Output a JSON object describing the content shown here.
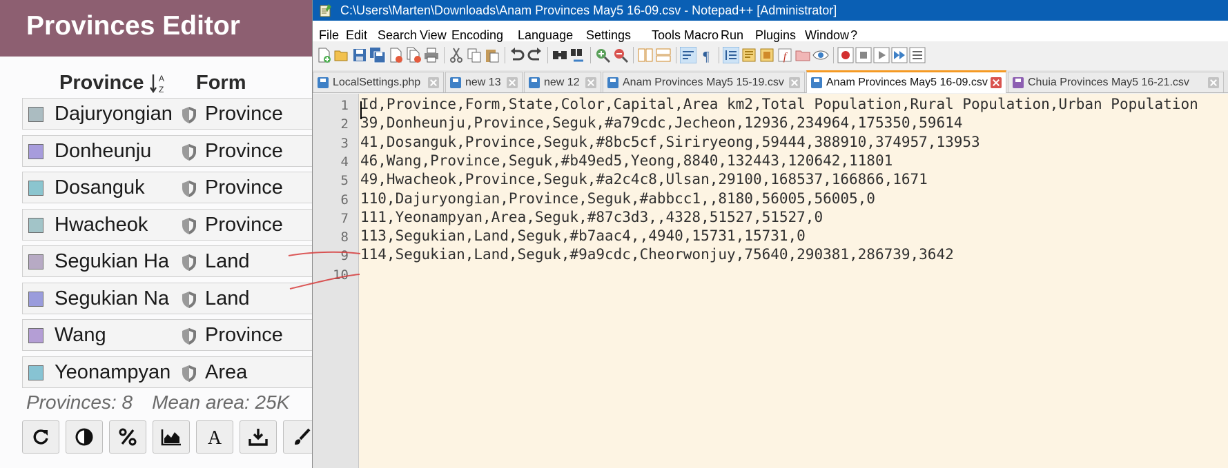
{
  "editor_panel": {
    "title": "Provinces Editor",
    "columns": {
      "province": "Province",
      "form": "Form"
    },
    "rows": [
      {
        "name": "Dajuryongian",
        "form": "Province",
        "color": "#abbcc1"
      },
      {
        "name": "Donheunju",
        "form": "Province",
        "color": "#a79cdc"
      },
      {
        "name": "Dosanguk",
        "form": "Province",
        "color": "#8bc5cf"
      },
      {
        "name": "Hwacheok",
        "form": "Province",
        "color": "#a2c4c8"
      },
      {
        "name": "Segukian Ha",
        "form": "Land",
        "color": "#b7aac4"
      },
      {
        "name": "Segukian Na",
        "form": "Land",
        "color": "#9a9cdc"
      },
      {
        "name": "Wang",
        "form": "Province",
        "color": "#b49ed5"
      },
      {
        "name": "Yeonampyan",
        "form": "Area",
        "color": "#87c3d3"
      }
    ],
    "stats": {
      "provinces": "Provinces: 8",
      "mean_area": "Mean area: 25K"
    },
    "toolbar_icons": [
      "refresh-icon",
      "contrast-icon",
      "percent-icon",
      "area-chart-icon",
      "font-icon",
      "download-icon",
      "brush-icon"
    ]
  },
  "notepad": {
    "title": "C:\\Users\\Marten\\Downloads\\Anam Provinces May5 16-09.csv - Notepad++ [Administrator]",
    "menu": [
      "File",
      "Edit",
      "Search",
      "View",
      "Encoding",
      "Language",
      "Settings",
      "Tools",
      "Macro",
      "Run",
      "Plugins",
      "Window",
      "?"
    ],
    "tabs": [
      {
        "label": "LocalSettings.php",
        "active": false
      },
      {
        "label": "new 13",
        "active": false
      },
      {
        "label": "new 12",
        "active": false
      },
      {
        "label": "Anam Provinces May5 15-19.csv",
        "active": false
      },
      {
        "label": "Anam Provinces May5 16-09.csv",
        "active": true
      },
      {
        "label": "Chuia Provinces May5 16-21.csv",
        "active": false
      }
    ],
    "line_numbers": [
      "1",
      "2",
      "3",
      "4",
      "5",
      "6",
      "7",
      "8",
      "9",
      "10"
    ],
    "lines": [
      "Id,Province,Form,State,Color,Capital,Area km2,Total Population,Rural Population,Urban Population",
      "39,Donheunju,Province,Seguk,#a79cdc,Jecheon,12936,234964,175350,59614",
      "41,Dosanguk,Province,Seguk,#8bc5cf,Siriryeong,59444,388910,374957,13953",
      "46,Wang,Province,Seguk,#b49ed5,Yeong,8840,132443,120642,11801",
      "49,Hwacheok,Province,Seguk,#a2c4c8,Ulsan,29100,168537,166866,1671",
      "110,Dajuryongian,Province,Seguk,#abbcc1,,8180,56005,56005,0",
      "111,Yeonampyan,Area,Seguk,#87c3d3,,4328,51527,51527,0",
      "113,Segukian,Land,Seguk,#b7aac4,,4940,15731,15731,0",
      "114,Segukian,Land,Seguk,#9a9cdc,Cheorwonjuy,75640,290381,286739,3642",
      ""
    ]
  },
  "colors": {
    "panel_header": "#8d5f71",
    "titlebar": "#0a5fb4",
    "editor_bg": "#fdf4e3",
    "active_tab_accent": "#f59a23",
    "annotation_red": "#d63a3a"
  }
}
